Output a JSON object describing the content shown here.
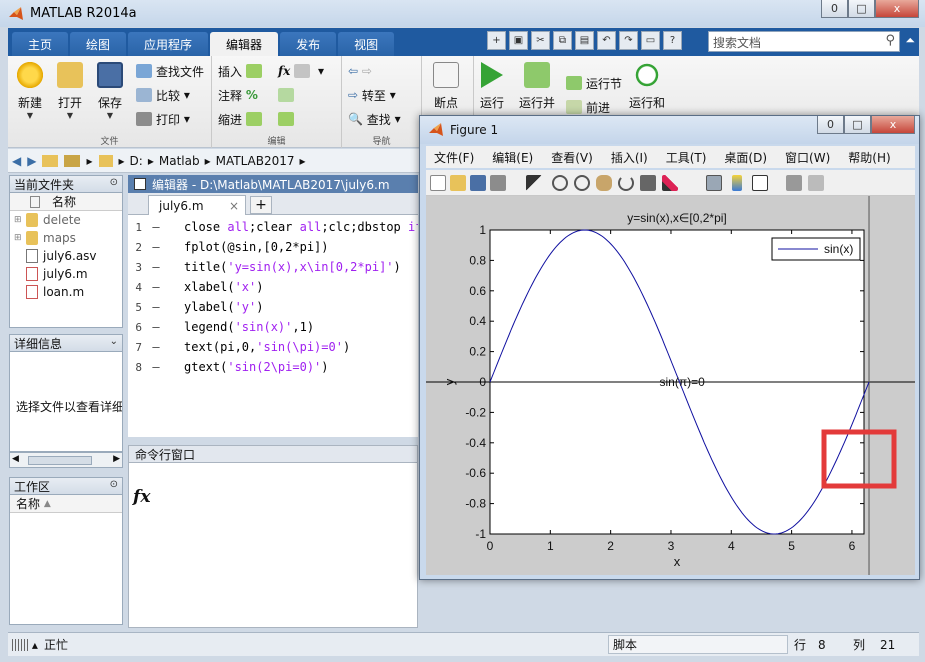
{
  "app": {
    "title": "MATLAB R2014a",
    "window_buttons": [
      "0",
      "□",
      "x"
    ]
  },
  "ribbon": {
    "tabs": [
      "主页",
      "绘图",
      "应用程序",
      "编辑器",
      "发布",
      "视图"
    ],
    "active_tab": "编辑器",
    "search_placeholder": "搜索文档",
    "file_group": {
      "label": "文件",
      "new": "新建",
      "open": "打开",
      "save": "保存",
      "find_files": "查找文件",
      "compare": "比较",
      "print": "打印"
    },
    "edit_group": {
      "label": "编辑",
      "insert": "插入",
      "comment": "注释",
      "indent": "缩进",
      "fx": "fx"
    },
    "nav_group": {
      "label": "导航",
      "goto": "转至",
      "find": "查找"
    },
    "breakpoints": "断点",
    "run": "运行",
    "run_advance": "运行并",
    "run_section": "运行节",
    "advance": "前进",
    "run_time": "运行和"
  },
  "address": {
    "parts": [
      "D:",
      "Matlab",
      "MATLAB2017"
    ]
  },
  "current_folder": {
    "title": "当前文件夹",
    "column": "名称",
    "items": [
      {
        "name": "delete",
        "type": "folder"
      },
      {
        "name": "maps",
        "type": "folder"
      },
      {
        "name": "july6.asv",
        "type": "file"
      },
      {
        "name": "july6.m",
        "type": "file"
      },
      {
        "name": "loan.m",
        "type": "file"
      }
    ]
  },
  "details": {
    "title": "详细信息",
    "message": "选择文件以查看详细"
  },
  "workspace": {
    "title": "工作区",
    "column": "名称"
  },
  "editor": {
    "title": "编辑器 - D:\\Matlab\\MATLAB2017\\july6.m",
    "tab": "july6.m",
    "lines": [
      {
        "n": "1",
        "pre": "close ",
        "str": "all",
        "mid": ";clear ",
        "str2": "all",
        "post": ";clc;dbstop ",
        "str3": "if"
      },
      {
        "n": "2",
        "pre": "fplot(@sin,[0,2*pi])",
        "str": "",
        "mid": "",
        "str2": "",
        "post": "",
        "str3": ""
      },
      {
        "n": "3",
        "pre": "title(",
        "str": "'y=sin(x),x\\in[0,2*pi]'",
        "mid": ")",
        "str2": "",
        "post": "",
        "str3": ""
      },
      {
        "n": "4",
        "pre": "xlabel(",
        "str": "'x'",
        "mid": ")",
        "str2": "",
        "post": "",
        "str3": ""
      },
      {
        "n": "5",
        "pre": "ylabel(",
        "str": "'y'",
        "mid": ")",
        "str2": "",
        "post": "",
        "str3": ""
      },
      {
        "n": "6",
        "pre": "legend(",
        "str": "'sin(x)'",
        "mid": ",1)",
        "str2": "",
        "post": "",
        "str3": ""
      },
      {
        "n": "7",
        "pre": "text(pi,0,",
        "str": "'sin(\\pi)=0'",
        "mid": ")",
        "str2": "",
        "post": "",
        "str3": ""
      },
      {
        "n": "8",
        "pre": "gtext(",
        "str": "'sin(2\\pi=0)'",
        "mid": ")",
        "str2": "",
        "post": "",
        "str3": ""
      }
    ]
  },
  "command": {
    "title": "命令行窗口",
    "prompt": "fx"
  },
  "status": {
    "state": "正忙",
    "script": "脚本",
    "row_label": "行",
    "row": "8",
    "col_label": "列",
    "col": "21"
  },
  "figure": {
    "title": "Figure 1",
    "menu": [
      "文件(F)",
      "编辑(E)",
      "查看(V)",
      "插入(I)",
      "工具(T)",
      "桌面(D)",
      "窗口(W)",
      "帮助(H)"
    ]
  },
  "colors": {
    "curve": "#1010a0",
    "highlight_box": "#e33a3a",
    "ribbon_blue": "#1f5aa0"
  },
  "chart_data": {
    "type": "line",
    "title": "y=sin(x),x∈[0,2*pi]",
    "xlabel": "x",
    "ylabel": "y",
    "xlim": [
      0,
      6.2832
    ],
    "ylim": [
      -1,
      1
    ],
    "xticks": [
      "0",
      "1",
      "2",
      "3",
      "4",
      "5",
      "6"
    ],
    "yticks": [
      "1",
      "0.8",
      "0.6",
      "0.4",
      "0.2",
      "0",
      "-0.2",
      "-0.4",
      "-0.6",
      "-0.8",
      "-1"
    ],
    "series": [
      {
        "name": "sin(x)",
        "function": "sin",
        "x_start": 0,
        "x_end": 6.2832
      }
    ],
    "annotations": [
      {
        "text": "sin(π)=0",
        "x": 3.1416,
        "y": 0
      }
    ],
    "legend": "top-right",
    "grid": false
  }
}
